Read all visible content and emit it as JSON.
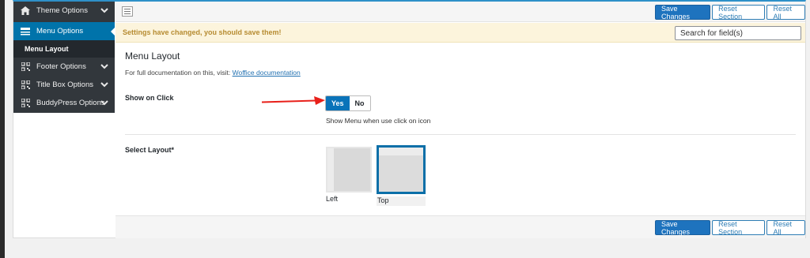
{
  "sidebar": {
    "items": [
      {
        "label": "Theme Options",
        "icon": "home-icon"
      },
      {
        "label": "Menu Options",
        "icon": "menu-icon"
      },
      {
        "label": "Menu Layout"
      },
      {
        "label": "Footer Options",
        "icon": "grid-icon"
      },
      {
        "label": "Title Box Options",
        "icon": "grid-icon"
      },
      {
        "label": "BuddyPress Options",
        "icon": "grid-icon"
      }
    ]
  },
  "toolbar": {
    "save_label": "Save Changes",
    "reset_section_label": "Reset Section",
    "reset_all_label": "Reset All"
  },
  "notice": {
    "text": "Settings have changed, you should save them!"
  },
  "search": {
    "placeholder": "Search for field(s)"
  },
  "section": {
    "title": "Menu Layout",
    "doc_prefix": "For full documentation on this, visit:",
    "doc_link": "Woffice documentation"
  },
  "fields": {
    "show_on_click": {
      "label": "Show on Click",
      "yes": "Yes",
      "no": "No",
      "selected": "Yes",
      "description": "Show Menu when use click on icon"
    },
    "select_layout": {
      "label": "Select Layout*",
      "options": [
        "Left",
        "Top"
      ],
      "selected": "Top"
    }
  },
  "colors": {
    "accent": "#0073aa",
    "primary_button": "#1e73be",
    "notice_text": "#b68b31",
    "arrow": "#e8201a"
  }
}
